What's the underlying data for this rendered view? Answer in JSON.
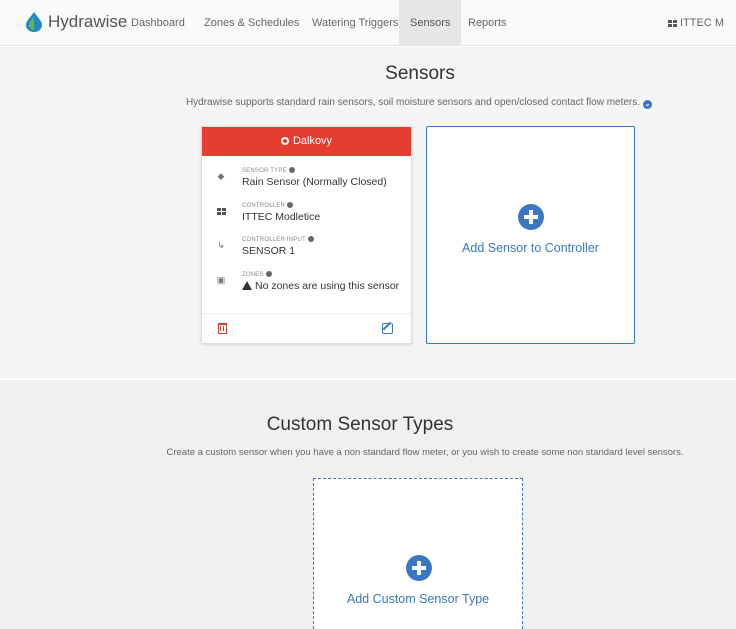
{
  "navbar": {
    "brand": "Hydrawise",
    "links": [
      "Dashboard",
      "Zones & Schedules",
      "Watering Triggers",
      "Sensors",
      "Reports"
    ],
    "active": "Sensors",
    "account_label": "ITTEC M"
  },
  "sensors": {
    "title": "Sensors",
    "description": "Hydrawise supports standard rain sensors, soil moisture sensors and open/closed contact flow meters.",
    "card": {
      "name": "Dalkovy",
      "fields": [
        {
          "label": "SENSOR TYPE",
          "value": "Rain Sensor (Normally Closed)",
          "icon": "tags-icon"
        },
        {
          "label": "CONTROLLER",
          "value": "ITTEC Modletice",
          "icon": "grid-icon"
        },
        {
          "label": "CONTROLLER INPUT",
          "value": "SENSOR 1",
          "icon": "input-arrow-icon"
        },
        {
          "label": "ZONES",
          "value": "No zones are using this sensor",
          "icon": "inbox-icon"
        }
      ]
    },
    "add_label": "Add Sensor to Controller"
  },
  "custom_types": {
    "title": "Custom Sensor Types",
    "description": "Create a custom sensor when you have a non standard flow meter, or you wish to create some non standard level sensors.",
    "add_label": "Add Custom Sensor Type"
  },
  "colors": {
    "accent": "#3a77c0",
    "header_red": "#e53d2f"
  }
}
